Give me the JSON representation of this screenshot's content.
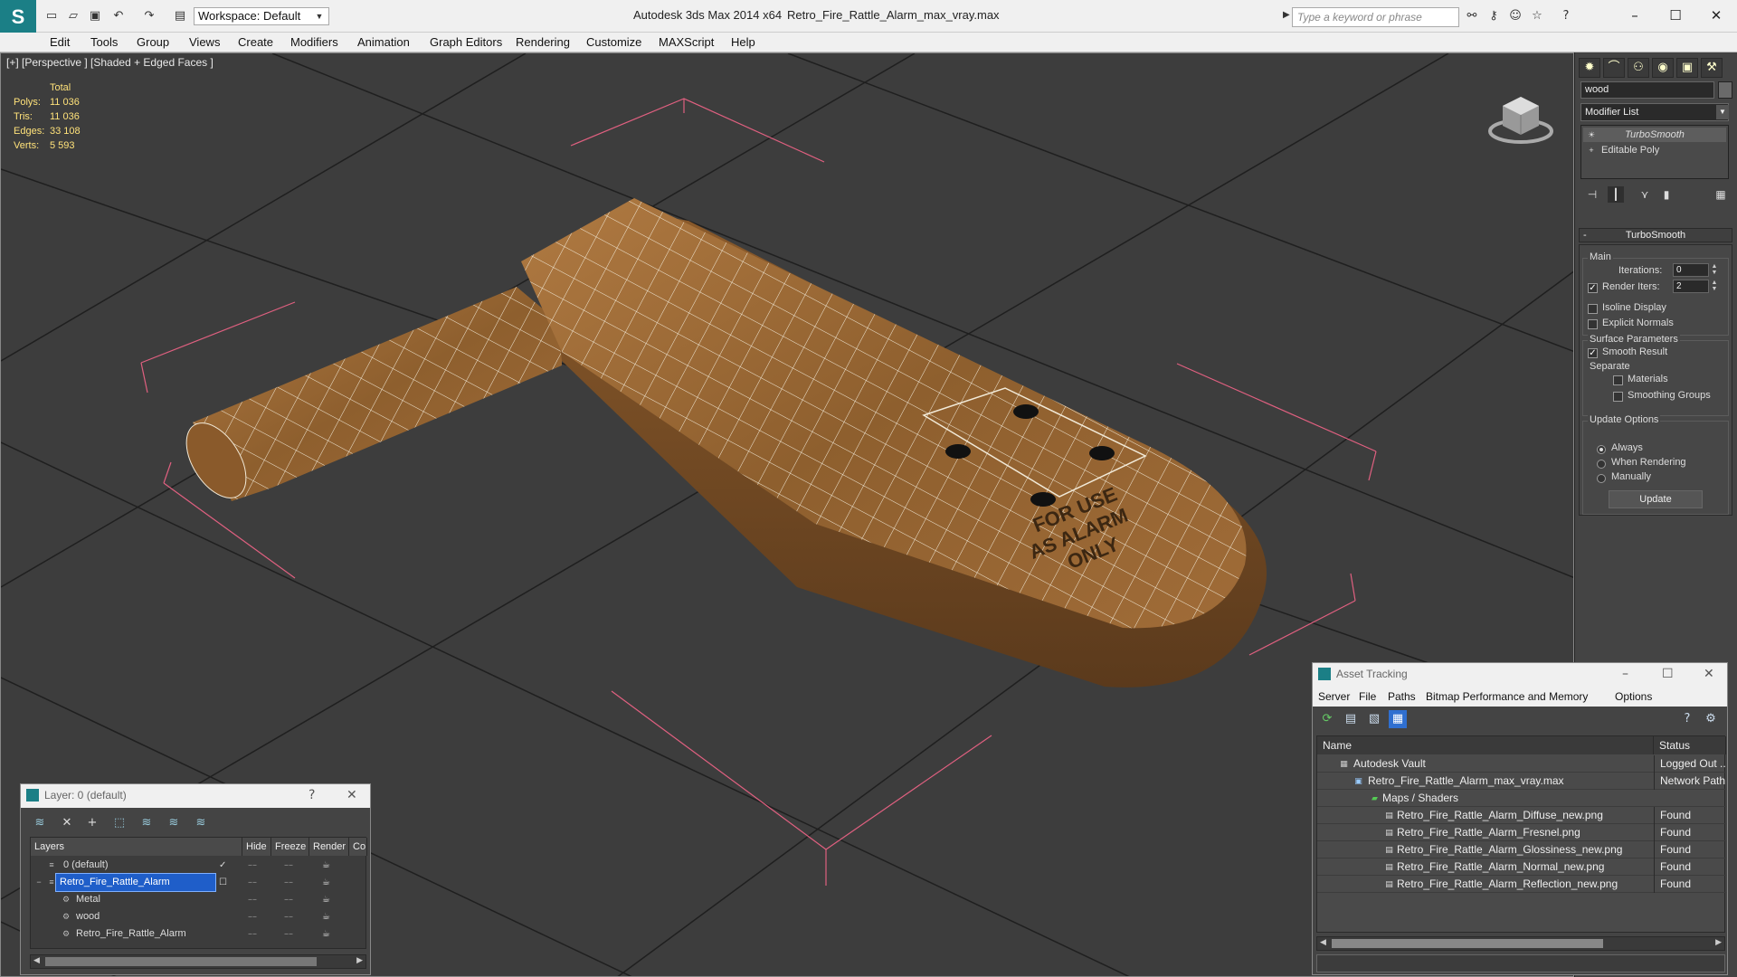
{
  "titlebar": {
    "logo": "S",
    "workspace": "Workspace: Default",
    "app_title": "Autodesk 3ds Max  2014 x64",
    "file_title": "Retro_Fire_Rattle_Alarm_max_vray.max",
    "search_placeholder": "Type a keyword or phrase"
  },
  "menu": [
    "Edit",
    "Tools",
    "Group",
    "Views",
    "Create",
    "Modifiers",
    "Animation",
    "Graph Editors",
    "Rendering",
    "Customize",
    "MAXScript",
    "Help"
  ],
  "viewport": {
    "label": "[+] [Perspective ] [Shaded + Edged Faces ]",
    "stats": {
      "header": "Total",
      "rows": [
        {
          "label": "Polys:",
          "value": "11 036"
        },
        {
          "label": "Tris:",
          "value": "11 036"
        },
        {
          "label": "Edges:",
          "value": "33 108"
        },
        {
          "label": "Verts:",
          "value": "5 593"
        }
      ]
    },
    "decal_text": [
      "FOR USE",
      "AS ALARM",
      "ONLY"
    ]
  },
  "command_panel": {
    "object_name": "wood",
    "modifier_list": "Modifier List",
    "stack": [
      "TurboSmooth",
      "Editable Poly"
    ],
    "rollout_title": "TurboSmooth",
    "main_group": "Main",
    "iterations_label": "Iterations:",
    "iterations_value": "0",
    "render_iters_label": "Render Iters:",
    "render_iters_value": "2",
    "isoline_label": "Isoline Display",
    "explicit_normals_label": "Explicit Normals",
    "surface_group": "Surface Parameters",
    "smooth_result_label": "Smooth Result",
    "separate_label": "Separate",
    "materials_label": "Materials",
    "smoothing_groups_label": "Smoothing Groups",
    "update_group": "Update Options",
    "always_label": "Always",
    "when_rendering_label": "When Rendering",
    "manually_label": "Manually",
    "update_button": "Update"
  },
  "layer_dialog": {
    "title": "Layer: 0 (default)",
    "help": "?",
    "close": "✕",
    "columns": [
      "Layers",
      "Hide",
      "Freeze",
      "Render",
      "Co"
    ],
    "rows": [
      {
        "name": "0 (default)",
        "indent": 0,
        "selected": false
      },
      {
        "name": "Retro_Fire_Rattle_Alarm",
        "indent": 0,
        "selected": true
      },
      {
        "name": "Metal",
        "indent": 1,
        "selected": false
      },
      {
        "name": "wood",
        "indent": 1,
        "selected": false
      },
      {
        "name": "Retro_Fire_Rattle_Alarm",
        "indent": 1,
        "selected": false
      }
    ]
  },
  "asset_dialog": {
    "title": "Asset Tracking",
    "menu": [
      "Server",
      "File",
      "Paths",
      "Bitmap Performance and Memory",
      "Options"
    ],
    "columns": [
      "Name",
      "Status"
    ],
    "rows": [
      {
        "name": "Autodesk Vault",
        "status": "Logged Out ...",
        "indent": 0
      },
      {
        "name": "Retro_Fire_Rattle_Alarm_max_vray.max",
        "status": "Network Path",
        "indent": 1
      },
      {
        "name": "Maps / Shaders",
        "status": "",
        "indent": 2
      },
      {
        "name": "Retro_Fire_Rattle_Alarm_Diffuse_new.png",
        "status": "Found",
        "indent": 3
      },
      {
        "name": "Retro_Fire_Rattle_Alarm_Fresnel.png",
        "status": "Found",
        "indent": 3
      },
      {
        "name": "Retro_Fire_Rattle_Alarm_Glossiness_new.png",
        "status": "Found",
        "indent": 3
      },
      {
        "name": "Retro_Fire_Rattle_Alarm_Normal_new.png",
        "status": "Found",
        "indent": 3
      },
      {
        "name": "Retro_Fire_Rattle_Alarm_Reflection_new.png",
        "status": "Found",
        "indent": 3
      }
    ]
  },
  "colors": {
    "accent": "#1b7f86",
    "selection": "#1f5ec9",
    "stats": "#ffe27a",
    "bbox": "#e06080",
    "wood": "#9a6a35"
  }
}
